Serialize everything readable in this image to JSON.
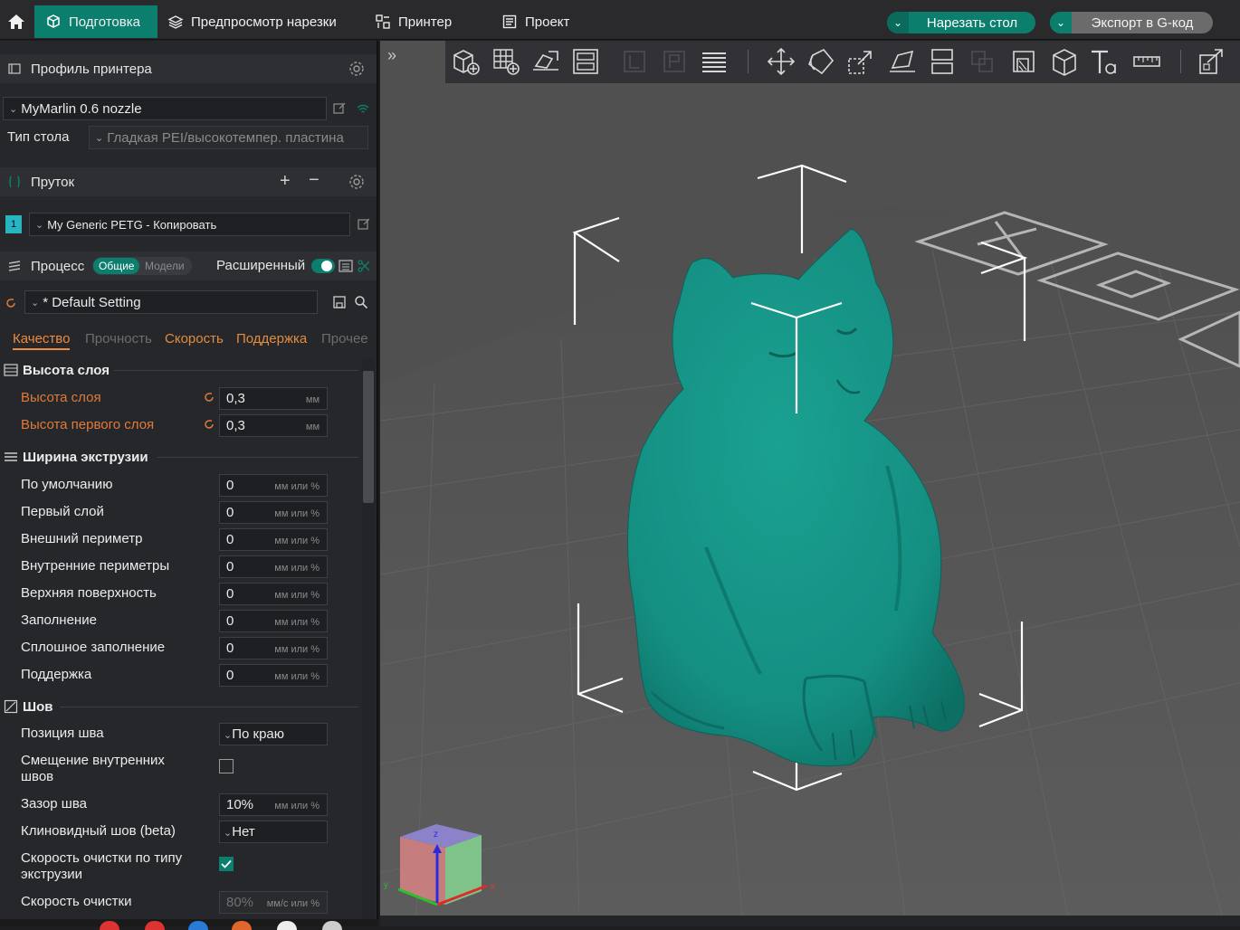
{
  "topbar": {
    "tabs": [
      {
        "label": "Подготовка",
        "active": true
      },
      {
        "label": "Предпросмотр нарезки"
      },
      {
        "label": "Принтер"
      },
      {
        "label": "Проект"
      }
    ],
    "slice_button": "Нарезать стол",
    "export_button": "Экспорт в G-код"
  },
  "printer": {
    "title": "Профиль принтера",
    "profile": "MyMarlin 0.6 nozzle",
    "bed_label": "Тип стола",
    "bed_value": "Гладкая PEI/высокотемпер. пластина"
  },
  "filament": {
    "title": "Пруток",
    "slot": "1",
    "value": "My Generic PETG - Копировать"
  },
  "process": {
    "title": "Процесс",
    "toggle_global": "Общие",
    "toggle_models": "Модели",
    "advanced": "Расширенный",
    "preset": "* Default Setting"
  },
  "subtabs": [
    "Качество",
    "Прочность",
    "Скорость",
    "Поддержка",
    "Прочее"
  ],
  "groups": {
    "layer_height": {
      "title": "Высота слоя",
      "rows": [
        {
          "label": "Высота слоя",
          "value": "0,3",
          "unit": "мм"
        },
        {
          "label": "Высота первого слоя",
          "value": "0,3",
          "unit": "мм"
        }
      ]
    },
    "line_width": {
      "title": "Ширина экструзии",
      "rows": [
        {
          "label": "По умолчанию",
          "value": "0",
          "unit": "мм или %"
        },
        {
          "label": "Первый слой",
          "value": "0",
          "unit": "мм или %"
        },
        {
          "label": "Внешний периметр",
          "value": "0",
          "unit": "мм или %"
        },
        {
          "label": "Внутренние периметры",
          "value": "0",
          "unit": "мм или %"
        },
        {
          "label": "Верхняя поверхность",
          "value": "0",
          "unit": "мм или %"
        },
        {
          "label": "Заполнение",
          "value": "0",
          "unit": "мм или %"
        },
        {
          "label": "Сплошное заполнение",
          "value": "0",
          "unit": "мм или %"
        },
        {
          "label": "Поддержка",
          "value": "0",
          "unit": "мм или %"
        }
      ]
    },
    "seam": {
      "title": "Шов",
      "seam_position_label": "Позиция шва",
      "seam_position_value": "По краю",
      "inner_seam_label": "Смещение внутренних швов",
      "gap_label": "Зазор шва",
      "gap_value": "10%",
      "gap_unit": "мм или %",
      "scarf_label": "Клиновидный шов (beta)",
      "scarf_value": "Нет",
      "wipe_by_type_label": "Скорость очистки по типу экструзии",
      "wipe_speed_label": "Скорость очистки",
      "wipe_speed_value": "80%",
      "wipe_speed_unit": "мм/с или %"
    }
  },
  "viewport": {
    "model_color": "#148f82",
    "axes": {
      "z": "z",
      "y": "y",
      "x": "x"
    }
  },
  "colors": {
    "accent": "#0c7e6e",
    "warning": "#e07a3a"
  }
}
